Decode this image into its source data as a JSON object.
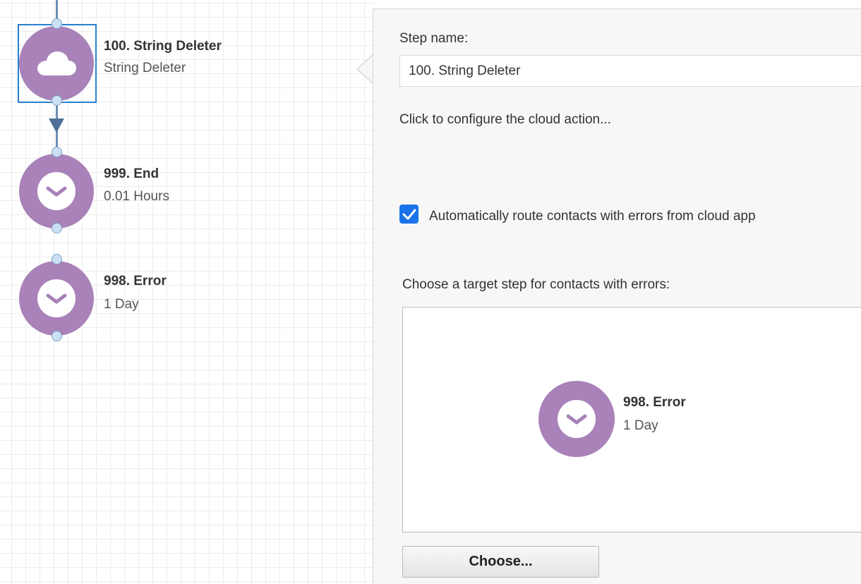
{
  "canvas": {
    "nodes": [
      {
        "title": "100. String Deleter",
        "subtitle": "String Deleter",
        "icon": "cloud-icon",
        "selected": true
      },
      {
        "title": "999. End",
        "subtitle": "0.01 Hours",
        "icon": "clock-icon",
        "selected": false
      },
      {
        "title": "998. Error",
        "subtitle": "1 Day",
        "icon": "clock-icon",
        "selected": false
      }
    ]
  },
  "panel": {
    "step_name_label": "Step name:",
    "step_name_value": "100. String Deleter",
    "configure_link": "Click to configure the cloud action...",
    "auto_route_label": "Automatically route contacts with errors from cloud app",
    "auto_route_checked": true,
    "target_label": "Choose a target step for contacts with errors:",
    "target_node": {
      "title": "998. Error",
      "subtitle": "1 Day",
      "icon": "clock-icon"
    },
    "choose_button": "Choose..."
  },
  "colors": {
    "node_fill": "#a882b8",
    "selection": "#2a7fd0",
    "checkbox": "#1a73e8",
    "connector": "#6c8fb4"
  }
}
